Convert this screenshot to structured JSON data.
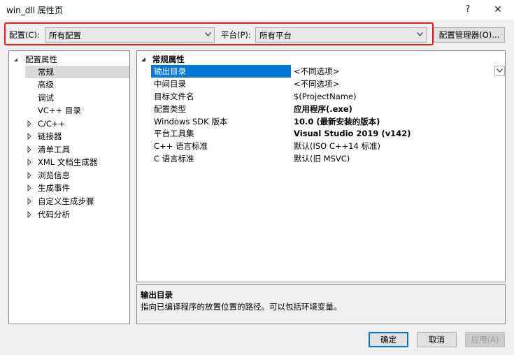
{
  "window": {
    "title": "win_dll 属性页",
    "help_label": "?",
    "close_label": "✕"
  },
  "config_row": {
    "config_label": "配置(C):",
    "config_value": "所有配置",
    "platform_label": "平台(P):",
    "platform_value": "所有平台",
    "config_manager_label": "配置管理器(O)..."
  },
  "tree": {
    "items": [
      {
        "label": "配置属性",
        "expanded": true
      },
      {
        "label": "常规",
        "selected": true
      },
      {
        "label": "高级"
      },
      {
        "label": "调试"
      },
      {
        "label": "VC++ 目录"
      },
      {
        "label": "C/C++",
        "expandable": true
      },
      {
        "label": "链接器",
        "expandable": true
      },
      {
        "label": "清单工具",
        "expandable": true
      },
      {
        "label": "XML 文档生成器",
        "expandable": true
      },
      {
        "label": "浏览信息",
        "expandable": true
      },
      {
        "label": "生成事件",
        "expandable": true
      },
      {
        "label": "自定义生成步骤",
        "expandable": true
      },
      {
        "label": "代码分析",
        "expandable": true
      }
    ]
  },
  "properties": {
    "section_title": "常规属性",
    "rows": [
      {
        "name": "输出目录",
        "value": "<不同选项>",
        "selected": true
      },
      {
        "name": "中间目录",
        "value": "<不同选项>"
      },
      {
        "name": "目标文件名",
        "value": "$(ProjectName)"
      },
      {
        "name": "配置类型",
        "value": "应用程序(.exe)",
        "bold": true
      },
      {
        "name": "Windows SDK 版本",
        "value": "10.0 (最新安装的版本)",
        "bold": true
      },
      {
        "name": "平台工具集",
        "value": "Visual Studio 2019 (v142)",
        "bold": true
      },
      {
        "name": "C++ 语言标准",
        "value": "默认(ISO C++14 标准)"
      },
      {
        "name": "C 语言标准",
        "value": "默认(旧 MSVC)"
      }
    ]
  },
  "description": {
    "title": "输出目录",
    "text": "指向已编译程序的放置位置的路径。可以包括环境变量。"
  },
  "buttons": {
    "ok": "确定",
    "cancel": "取消",
    "apply": "应用(A)"
  },
  "icons": {
    "dropdown": "chevron-down-icon",
    "tree_collapsed": "triangle-right-icon",
    "tree_expanded": "triangle-down-icon"
  },
  "colors": {
    "highlight": "#0078d7",
    "annotation_box": "#e3201b"
  }
}
